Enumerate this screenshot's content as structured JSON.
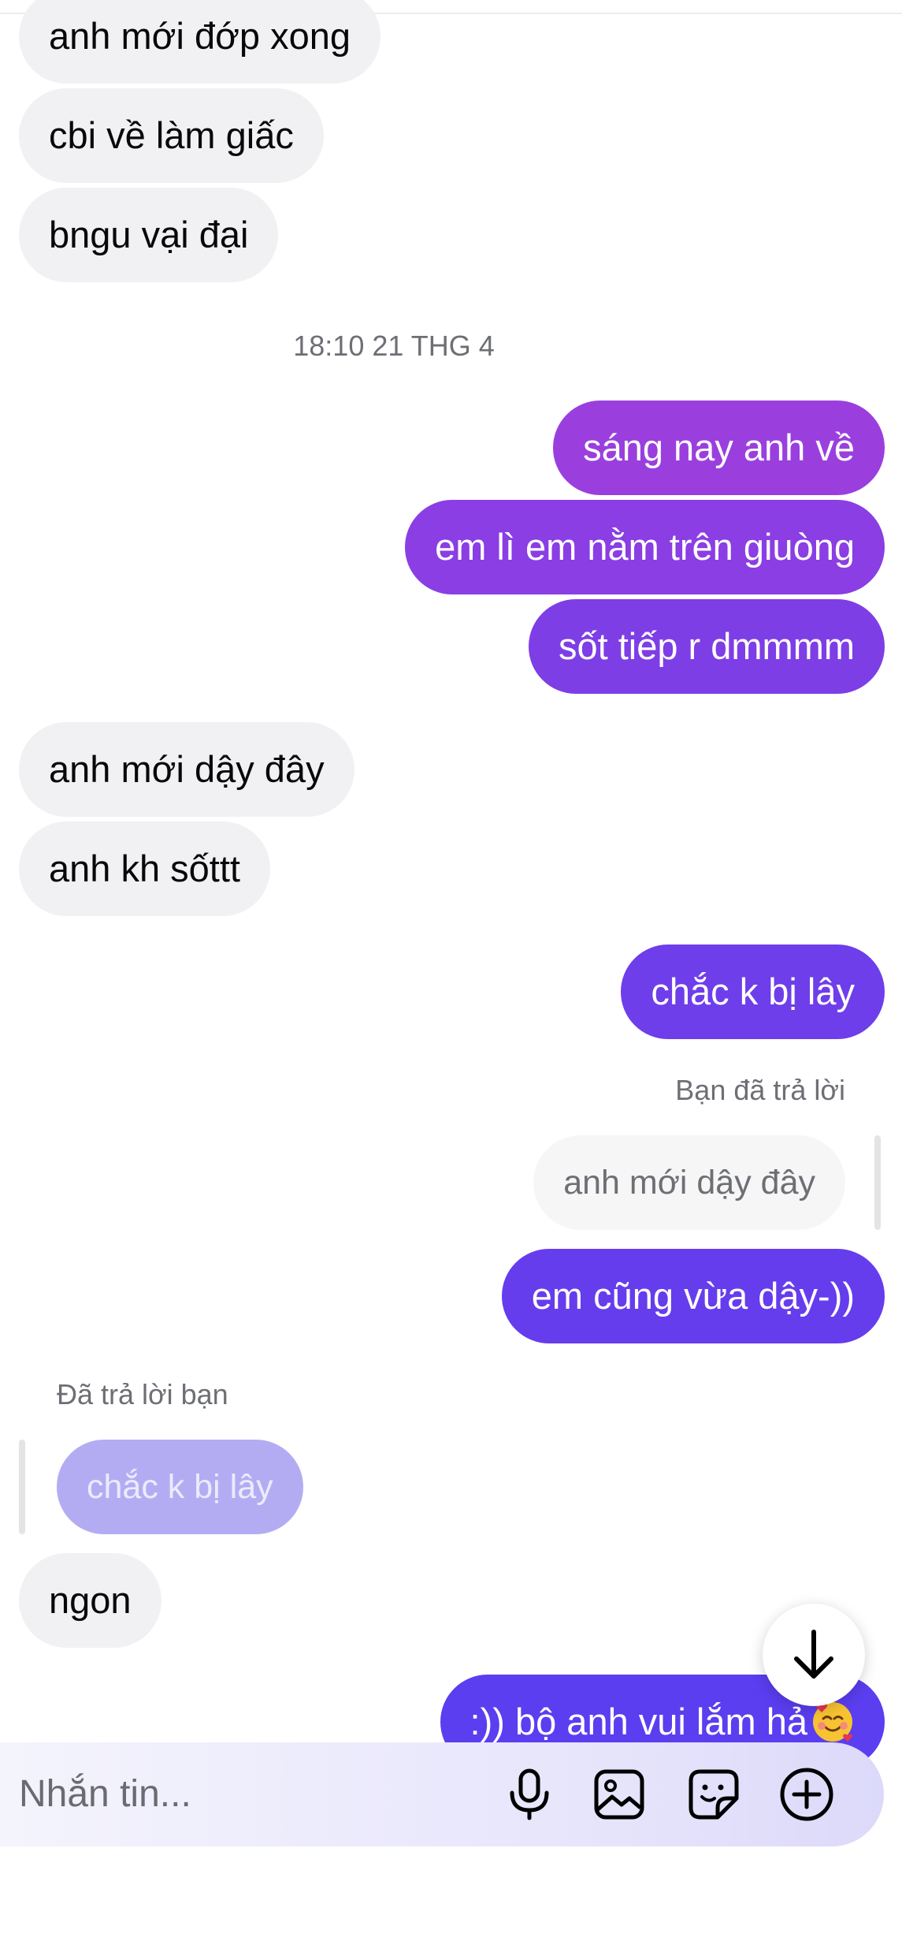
{
  "colors": {
    "incoming_bubble": "#f1f1f3",
    "outgoing_gradient_top": "#9a3fde",
    "outgoing_gradient_bottom": "#5a3ef0",
    "secondary_text": "#6d6f75"
  },
  "messages_before": [
    {
      "side": "incoming",
      "text": "anh mới đớp xong"
    },
    {
      "side": "incoming",
      "text": "cbi về làm giấc"
    },
    {
      "side": "incoming",
      "text": "bngu vại đại"
    }
  ],
  "timestamp": "18:10 21 THG 4",
  "messages_after": [
    {
      "side": "outgoing",
      "text": "sáng nay anh về"
    },
    {
      "side": "outgoing",
      "text": "em lì em nằm trên giuòng"
    },
    {
      "side": "outgoing",
      "text": "sốt tiếp r dmmmm"
    },
    {
      "side": "incoming",
      "text": "anh mới dậy đây"
    },
    {
      "side": "incoming",
      "text": "anh kh sốttt"
    },
    {
      "side": "outgoing",
      "text": "chắc k bị lây"
    }
  ],
  "reply_out": {
    "label": "Bạn đã trả lời",
    "quoted": "anh mới dậy đây",
    "text": "em cũng vừa dậy-))"
  },
  "reply_in": {
    "label": "Đã trả lời bạn",
    "quoted": "chắc k bị lây",
    "text": "ngon"
  },
  "last_message": {
    "side": "outgoing",
    "text": ":)) bộ anh vui lắm hả",
    "emoji": "smiling-face-with-hearts"
  },
  "scroll_button": {
    "icon": "arrow-down-icon"
  },
  "composer": {
    "placeholder": "Nhắn tin...",
    "icons": [
      "microphone-icon",
      "image-icon",
      "sticker-icon",
      "plus-circle-icon"
    ]
  }
}
